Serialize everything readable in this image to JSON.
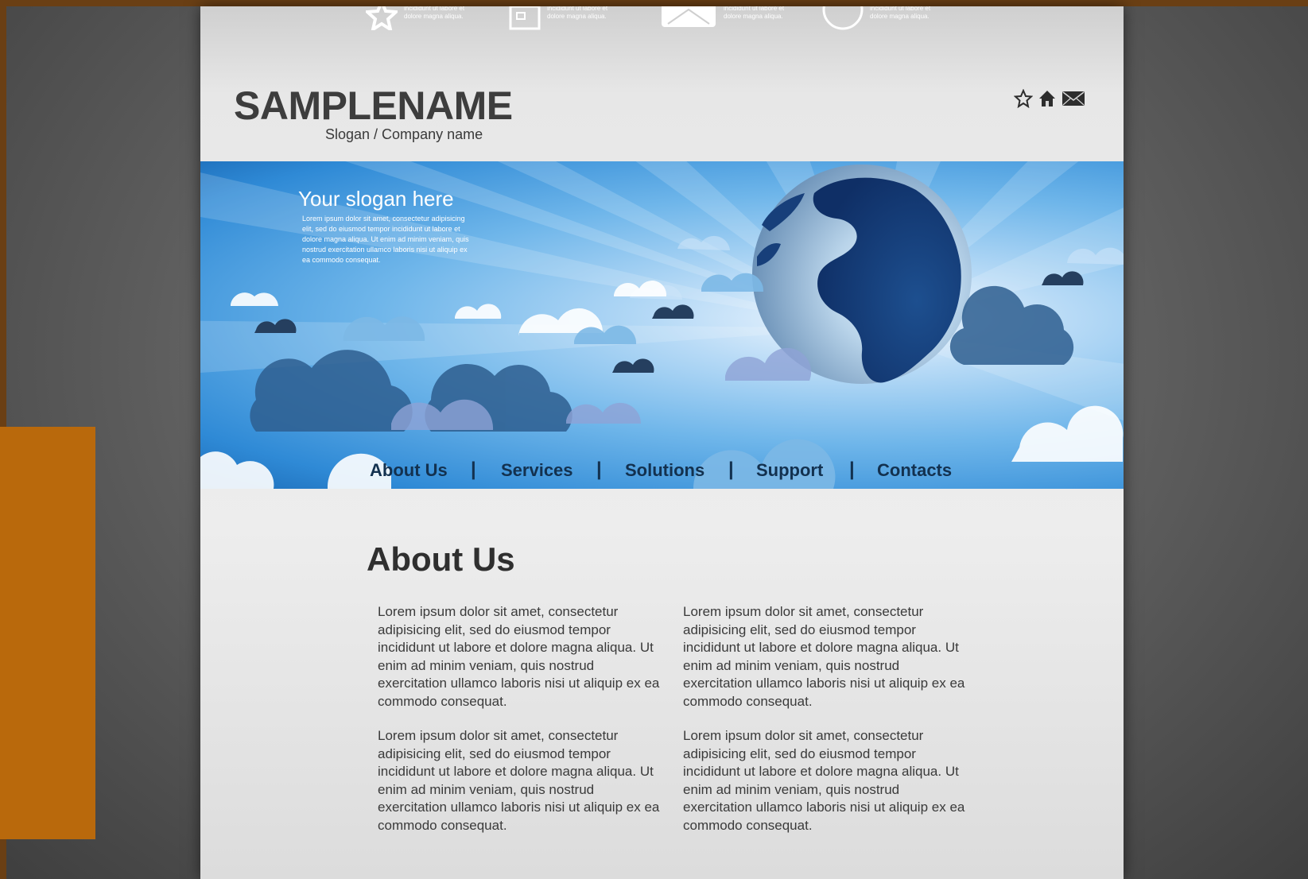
{
  "page": {
    "brand": "SAMPLENAME",
    "slogan": "Slogan / Company name"
  },
  "top_strip": {
    "features": [
      {
        "icon": "star-icon",
        "text": "incididunt ut labore et dolore magna aliqua."
      },
      {
        "icon": "building-icon",
        "text": "incididunt ut labore et dolore magna aliqua."
      },
      {
        "icon": "mail-icon",
        "text": "incididunt ut labore et dolore magna aliqua."
      },
      {
        "icon": "clock-icon",
        "text": "incididunt ut labore et dolore magna aliqua."
      }
    ]
  },
  "header_icons": [
    "star-icon",
    "home-icon",
    "mail-icon"
  ],
  "hero": {
    "slogan": "Your slogan here",
    "body": "Lorem ipsum dolor sit amet, consectetur adipisicing elit, sed do eiusmod tempor incididunt ut labore et dolore magna aliqua. Ut enim ad minim veniam, quis nostrud exercitation ullamco laboris nisi ut aliquip ex ea commodo consequat."
  },
  "nav": {
    "items": [
      "About Us",
      "Services",
      "Solutions",
      "Support",
      "Contacts"
    ],
    "separator": "|"
  },
  "content": {
    "title": "About Us",
    "paragraph": "Lorem ipsum dolor sit amet, consectetur adipisicing elit, sed do eiusmod tempor incididunt ut labore et dolore magna aliqua. Ut enim ad minim veniam, quis nostrud exercitation ullamco laboris nisi ut aliquip ex ea commodo consequat."
  },
  "colors": {
    "outer_border": "#6a3f14",
    "orange_block": "#b9690c",
    "nav_text": "#13314f",
    "hero_blue": "#2f8ad6"
  }
}
